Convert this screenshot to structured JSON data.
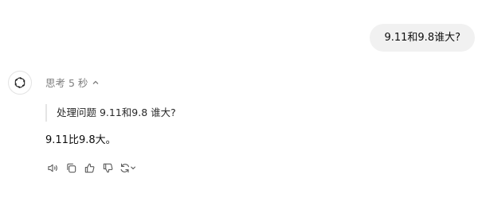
{
  "user_message": {
    "text": "9.11和9.8谁大?"
  },
  "assistant": {
    "avatar_icon": "chatgpt-logo-icon",
    "thinking": {
      "label": "思考 5 秒",
      "toggle_icon": "chevron-up-icon"
    },
    "thought_text": "处理问题 9.11和9.8 谁大?",
    "answer_text": "9.11比9.8大。",
    "actions": [
      {
        "icon": "speaker-icon",
        "title": "read-aloud"
      },
      {
        "icon": "copy-icon",
        "title": "copy"
      },
      {
        "icon": "thumbs-up-icon",
        "title": "good-response"
      },
      {
        "icon": "thumbs-down-icon",
        "title": "bad-response"
      },
      {
        "icon": "regenerate-icon",
        "title": "regenerate"
      }
    ]
  }
}
